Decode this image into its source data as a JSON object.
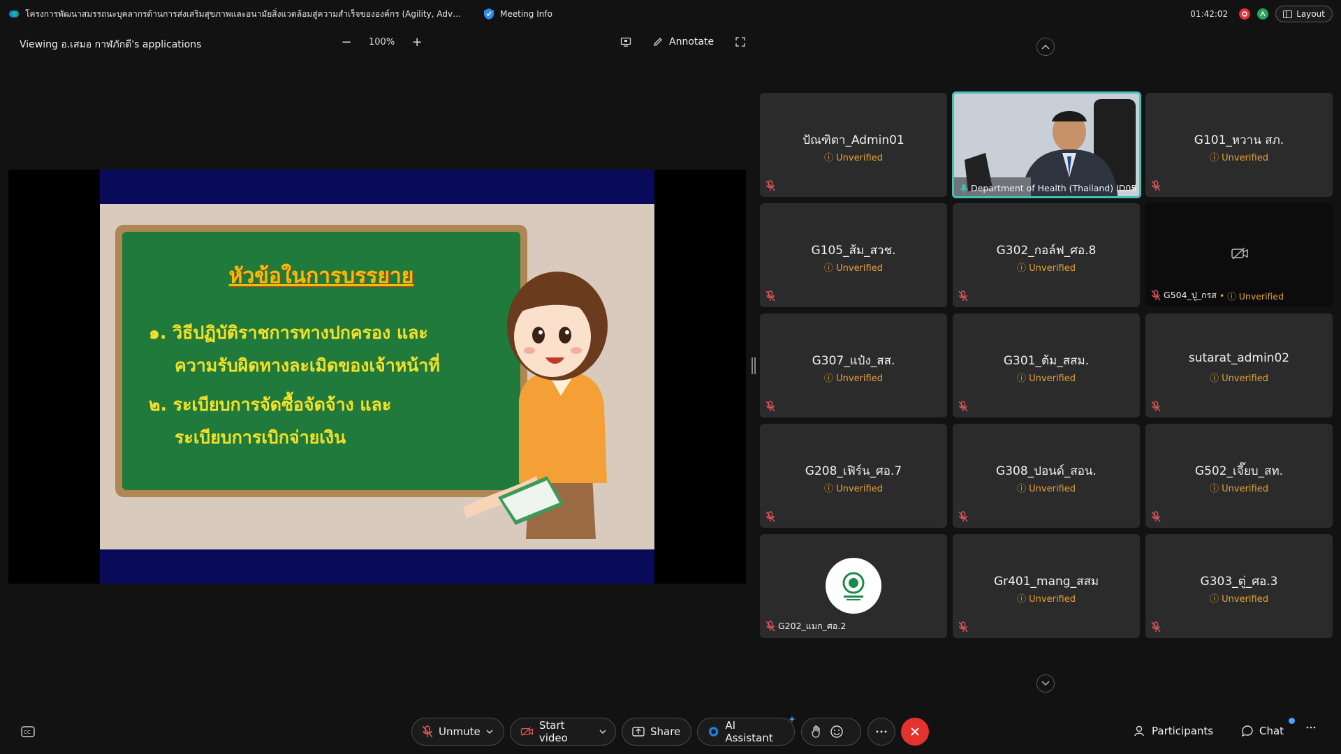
{
  "window": {
    "title": "โครงการพัฒนาสมรรถนะบุคลากรด้านการส่งเสริมสุขภาพและอนามัยสิ่งแวดล้อมสู่ความสำเร็จขององค์กร (Agility, Advanc...",
    "meeting_info_label": "Meeting Info",
    "clock": "01:42:02",
    "layout_label": "Layout"
  },
  "viewbar": {
    "viewing_label": "Viewing อ.เสมอ กาฬภักดี's applications",
    "zoom_value": "100%",
    "zoom_out": "−",
    "zoom_in": "+",
    "annotate_label": "Annotate"
  },
  "slide": {
    "heading": "หัวข้อในการบรรยาย",
    "lines": [
      "๑. วิธีปฏิบัติราชการทางปกครอง และ",
      "ความรับผิดทางละเมิดของเจ้าหน้าที่",
      "๒. ระเบียบการจัดซื้อจัดจ้าง และ",
      "ระเบียบการเบิกจ่ายเงิน"
    ]
  },
  "participants": [
    {
      "name": "ปัณฑิตา_Admin01",
      "status": "Unverified"
    },
    {
      "name": "Department of Health (Thailand) ID05",
      "status": ""
    },
    {
      "name": "G101_หวาน สภ.",
      "status": "Unverified"
    },
    {
      "name": "G105_ส้ม_สวช.",
      "status": "Unverified"
    },
    {
      "name": "G302_กอล์ฟ_ศอ.8",
      "status": "Unverified"
    },
    {
      "name": "G504_ปู_กรส",
      "status": "Unverified"
    },
    {
      "name": "G307_แป๋ง_สส.",
      "status": "Unverified"
    },
    {
      "name": "G301_ต้ม_สสม.",
      "status": "Unverified"
    },
    {
      "name": "sutarat_admin02",
      "status": "Unverified"
    },
    {
      "name": "G208_เฟิร์น_ศอ.7",
      "status": "Unverified"
    },
    {
      "name": "G308_ปอนด์_สอน.",
      "status": "Unverified"
    },
    {
      "name": "G502_เจี๊ยบ_สท.",
      "status": "Unverified"
    },
    {
      "name": "G202_แมก_ศอ.2",
      "status": ""
    },
    {
      "name": "Gr401_mang_สสม",
      "status": "Unverified"
    },
    {
      "name": "G303_ตู่_ศอ.3",
      "status": "Unverified"
    }
  ],
  "controls": {
    "unmute": "Unmute",
    "start_video": "Start video",
    "share": "Share",
    "ai_assistant": "AI Assistant",
    "participants": "Participants",
    "chat": "Chat"
  },
  "colors": {
    "accent_teal": "#3fc4b3",
    "unverified": "#e5a236",
    "leave_red": "#e5322d",
    "mute_red": "#e0555a"
  }
}
